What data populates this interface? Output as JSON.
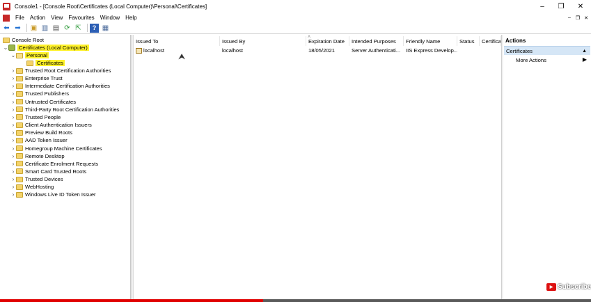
{
  "window": {
    "title": "Console1 - [Console Root\\Certificates (Local Computer)\\Personal\\Certificates]",
    "controls": [
      "–",
      "❐",
      "✕"
    ],
    "mdi_controls": [
      "–",
      "❐",
      "✕"
    ]
  },
  "menu": [
    "File",
    "Action",
    "View",
    "Favourites",
    "Window",
    "Help"
  ],
  "toolbar": {
    "buttons": [
      "back-arrow-icon",
      "forward-arrow-icon",
      "up-folder-icon",
      "show-hide-tree-icon",
      "properties-icon",
      "refresh-icon",
      "export-list-icon",
      "help-icon",
      "show-hide-action-pane-icon"
    ],
    "glyphs": [
      "⬅",
      "➡",
      "▣",
      "▥",
      "▤",
      "⟳",
      "⇱",
      "?",
      "▦"
    ]
  },
  "tree": {
    "console_root": "Console Root",
    "certificates_local": "Certificates (Local Computer)",
    "personal": "Personal",
    "certificates": "Certificates",
    "stores": [
      "Trusted Root Certification Authorities",
      "Enterprise Trust",
      "Intermediate Certification Authorities",
      "Trusted Publishers",
      "Untrusted Certificates",
      "Third-Party Root Certification Authorities",
      "Trusted People",
      "Client Authentication Issuers",
      "Preview Build Roots",
      "AAD Token Issuer",
      "Homegroup Machine Certificates",
      "Remote Desktop",
      "Certificate Enrolment Requests",
      "Smart Card Trusted Roots",
      "Trusted Devices",
      "WebHosting",
      "Windows Live ID Token Issuer"
    ]
  },
  "list": {
    "columns": [
      "Issued To",
      "Issued By",
      "Expiration Date",
      "Intended Purposes",
      "Friendly Name",
      "Status",
      "Certifica"
    ],
    "rows": [
      [
        "localhost",
        "localhost",
        "18/05/2021",
        "Server Authenticati...",
        "IIS Express Develop...",
        "",
        ""
      ]
    ]
  },
  "actions": {
    "title": "Actions",
    "section": "Certificates",
    "items": [
      "More Actions"
    ]
  },
  "overlay": {
    "subscribe": "Subscribe",
    "video_progress": 0.445
  },
  "colors": {
    "highlight": "#fff22a",
    "action_section_bg": "#d5e6f6",
    "progress": "#e00000"
  }
}
